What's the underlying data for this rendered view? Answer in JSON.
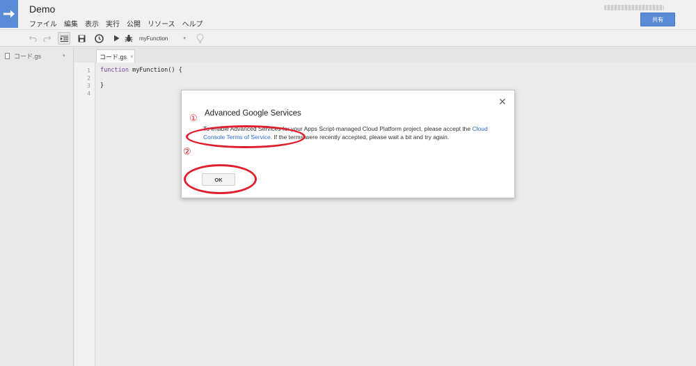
{
  "app": {
    "title": "Demo",
    "share_label": "共有",
    "accent": "#5b8ad6"
  },
  "menu": [
    "ファイル",
    "編集",
    "表示",
    "実行",
    "公開",
    "リソース",
    "ヘルプ"
  ],
  "toolbar": {
    "function_name": "myFunction",
    "icons": [
      "undo-icon",
      "redo-icon",
      "indent-icon",
      "save-icon",
      "triggers-clock-icon",
      "run-play-icon",
      "debug-bug-icon",
      "lightbulb-icon"
    ]
  },
  "sidebar": {
    "files": [
      {
        "name": "コード.gs"
      }
    ]
  },
  "editor": {
    "tab_label": "コード.gs",
    "tab_close": "×",
    "line_numbers": [
      "1",
      "2",
      "3",
      "4"
    ],
    "code": {
      "kw": "function",
      "rest": " myFunction() {",
      "close": "}"
    }
  },
  "dialog": {
    "title": "Advanced Google Services",
    "text_before_link": "To enable Advanced Services for your Apps Script-managed Cloud Platform project, please accept the ",
    "link_text": "Cloud Console Terms of Service",
    "text_after_link": ". If the terms were recently accepted, please wait a bit and try again.",
    "ok_label": "OK",
    "close_glyph": "✕"
  },
  "annotations": {
    "mark1": "①",
    "mark2": "②",
    "color": "#e01e2d"
  }
}
